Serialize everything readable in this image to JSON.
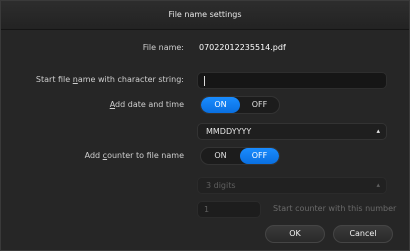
{
  "dialog": {
    "title": "File name settings",
    "file_name_label": "File name:",
    "file_name_value": "07022012235514.pdf",
    "start_string_label_pre": "Start file ",
    "start_string_label_accel": "n",
    "start_string_label_post": "ame with character string:",
    "start_string_value": "",
    "add_date_label_accel": "A",
    "add_date_label_post": "dd date and time",
    "add_date_toggle": {
      "on_label": "ON",
      "off_label": "OFF",
      "state": "ON"
    },
    "date_format_selected": "MMDDYYYY",
    "add_counter_label_pre": "Add ",
    "add_counter_label_accel": "c",
    "add_counter_label_post": "ounter to file name",
    "add_counter_toggle": {
      "on_label": "ON",
      "off_label": "OFF",
      "state": "OFF"
    },
    "digits_selected": "3 digits",
    "counter_start_value": "1",
    "counter_start_label": "Start counter with this number",
    "ok_label": "OK",
    "cancel_label": "Cancel"
  },
  "colors": {
    "accent": "#1a8cff",
    "background": "#262626",
    "input_background": "#161616"
  },
  "icons": {
    "select_chevron": "up-down-chevron-icon"
  }
}
